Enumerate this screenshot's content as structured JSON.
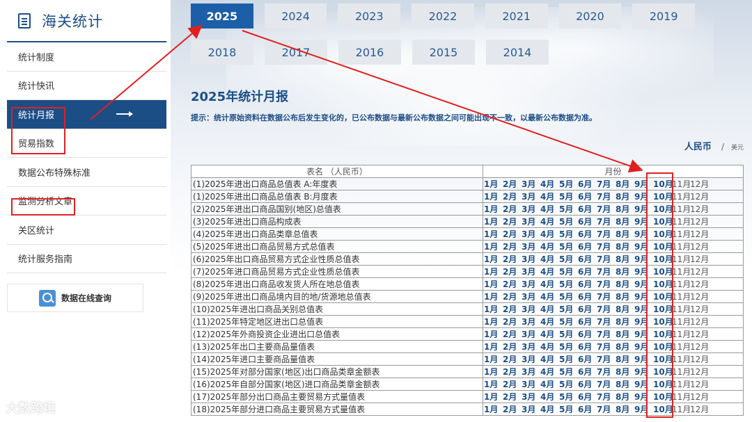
{
  "sidebar": {
    "title": "海关统计",
    "items": [
      {
        "label": "统计制度"
      },
      {
        "label": "统计快讯"
      },
      {
        "label": "统计月报"
      },
      {
        "label": "贸易指数"
      },
      {
        "label": "数据公布特殊标准"
      },
      {
        "label": "监测分析文章"
      },
      {
        "label": "关区统计"
      },
      {
        "label": "统计服务指南"
      }
    ],
    "search_label": "数据在线查询"
  },
  "years": {
    "row1": [
      "2025",
      "2024",
      "2023",
      "2022",
      "2021",
      "2020",
      "2019"
    ],
    "row2": [
      "2018",
      "2017",
      "2016",
      "2015",
      "2014"
    ],
    "active": "2025"
  },
  "content": {
    "title": "2025年统计月报",
    "hint": "提示：统计原始资料在数据公布后发生变化的，已公布数据与最新公布数据之间可能出现不一致，以最新公布数据为准。",
    "currency_rmb": "人民币",
    "currency_sep": "/",
    "currency_usd": "美元"
  },
  "table": {
    "header_name": "表名 （人民币）",
    "header_month": "月份",
    "months_available": [
      "1月",
      "2月",
      "3月",
      "4月",
      "5月",
      "6月",
      "7月",
      "8月",
      "9月",
      "10月"
    ],
    "months_na": [
      "11月",
      "12月"
    ],
    "rows": [
      "(1)2025年进出口商品总值表 A:年度表",
      "(1)2025年进出口商品总值表 B:月度表",
      "(2)2025年进出口商品国别(地区)总值表",
      "(3)2025年进出口商品构成表",
      "(4)2025年进出口商品类章总值表",
      "(5)2025年进出口商品贸易方式总值表",
      "(6)2025年出口商品贸易方式企业性质总值表",
      "(7)2025年进口商品贸易方式企业性质总值表",
      "(8)2025年进出口商品收发货人所在地总值表",
      "(9)2025年进出口商品境内目的地/货源地总值表",
      "(10)2025年进出口商品关别总值表",
      "(11)2025年特定地区进出口总值表",
      "(12)2025年外商投资企业进出口总值表",
      "(13)2025年出口主要商品量值表",
      "(14)2025年进口主要商品量值表",
      "(15)2025年对部分国家(地区)出口商品类章金额表",
      "(16)2025年自部分国家(地区)进口商品类章金额表",
      "(17)2025年部分出口商品主要贸易方式量值表",
      "(18)2025年部分进口商品主要贸易方式量值表"
    ]
  },
  "watermark": "大数跨境",
  "colors": {
    "brand": "#1c4e86",
    "active_tab": "#1c5fa8",
    "highlight": "#e02020"
  }
}
